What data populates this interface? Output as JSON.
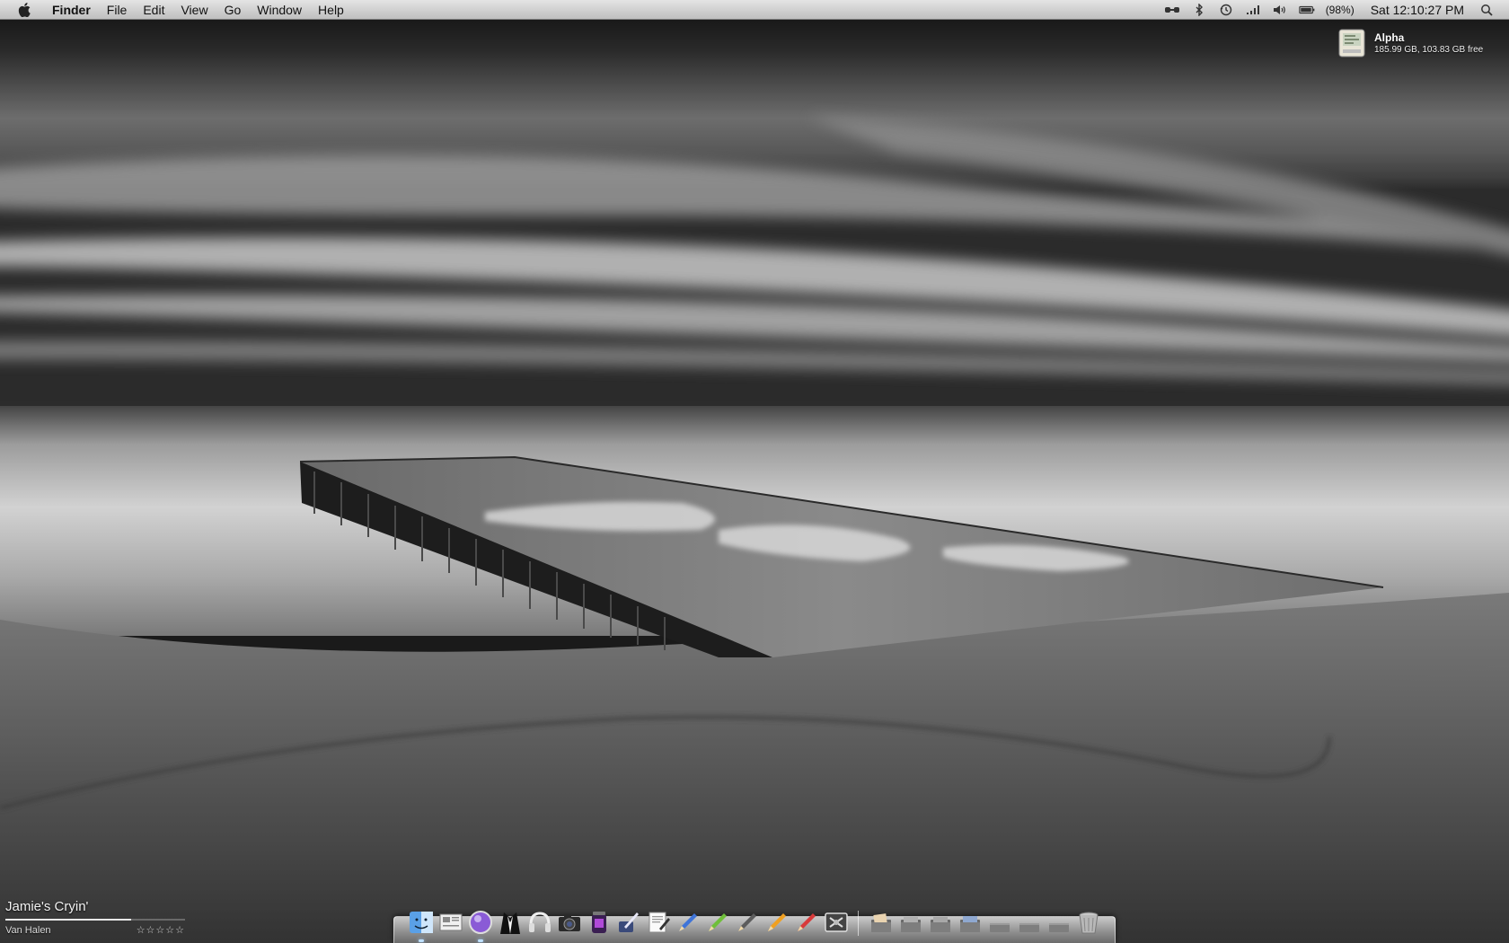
{
  "menubar": {
    "apple_icon": "apple-logo-icon",
    "app_name": "Finder",
    "menus": [
      "File",
      "Edit",
      "View",
      "Go",
      "Window",
      "Help"
    ],
    "status": {
      "battery_percent_label": "(98%)",
      "battery_level": 98,
      "clock": "Sat 12:10:27 PM",
      "icons": [
        "bridge-icon",
        "bluetooth-icon",
        "time-machine-icon",
        "wifi-icon",
        "volume-icon",
        "battery-icon",
        "spotlight-icon"
      ]
    }
  },
  "drive_widget": {
    "name": "Alpha",
    "info": "185.99 GB, 103.83 GB free",
    "icon": "hard-drive-icon"
  },
  "now_playing": {
    "track": "Jamie's Cryin'",
    "artist": "Van Halen",
    "rating": "☆☆☆☆☆",
    "progress_fraction": 0.7
  },
  "dock": {
    "apps": [
      {
        "name": "finder",
        "icon": "finder-icon",
        "running": true
      },
      {
        "name": "newspaper",
        "icon": "newspaper-icon",
        "running": false
      },
      {
        "name": "purple-orb",
        "icon": "purple-orb-icon",
        "running": true
      },
      {
        "name": "tuxedo",
        "icon": "tuxedo-icon",
        "running": false
      },
      {
        "name": "headphones",
        "icon": "headphones-icon",
        "running": false
      },
      {
        "name": "camera",
        "icon": "camera-icon",
        "running": false
      },
      {
        "name": "media-jar",
        "icon": "media-jar-icon",
        "running": false
      },
      {
        "name": "quill-pen",
        "icon": "quill-pen-icon",
        "running": false
      },
      {
        "name": "textedit",
        "icon": "textedit-icon",
        "running": false
      },
      {
        "name": "pencil-blue",
        "icon": "pencil-blue-icon",
        "running": false
      },
      {
        "name": "pencil-green",
        "icon": "pencil-green-icon",
        "running": false
      },
      {
        "name": "pencil-gray",
        "icon": "pencil-gray-icon",
        "running": false
      },
      {
        "name": "pencil-orange",
        "icon": "pencil-orange-icon",
        "running": false
      },
      {
        "name": "pencil-red",
        "icon": "pencil-red-icon",
        "running": false
      },
      {
        "name": "utility",
        "icon": "utility-icon",
        "running": false
      }
    ],
    "stacks": [
      {
        "name": "stack-1",
        "icon": "folder-stack-icon"
      },
      {
        "name": "stack-2",
        "icon": "folder-stack-icon"
      },
      {
        "name": "stack-3",
        "icon": "folder-stack-icon"
      },
      {
        "name": "stack-4",
        "icon": "folder-stack-icon"
      },
      {
        "name": "stack-5",
        "icon": "folder-stack-icon"
      },
      {
        "name": "stack-6",
        "icon": "folder-stack-icon"
      },
      {
        "name": "stack-7",
        "icon": "folder-stack-icon"
      },
      {
        "name": "trash",
        "icon": "trash-icon"
      }
    ]
  },
  "colors": {
    "menubar_top": "#e4e4e4",
    "menubar_bottom": "#bfbfbf",
    "wallpaper_sky": "#3a3a3a",
    "wallpaper_sand": "#5a5a5a",
    "running_indicator": "#bfe0ff"
  }
}
